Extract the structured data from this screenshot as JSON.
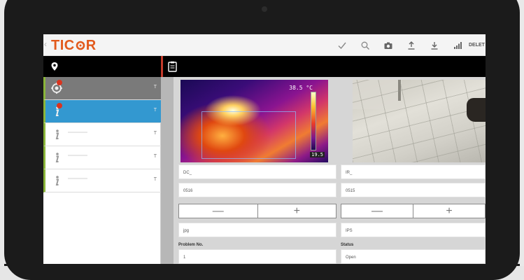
{
  "app": {
    "brand_left": "TIC",
    "brand_right": "R",
    "back_glyph": "‹"
  },
  "appbar_actions": [
    {
      "name": "checkmark-icon",
      "label": ""
    },
    {
      "name": "search-icon",
      "label": ""
    },
    {
      "name": "camera-icon",
      "label": ""
    },
    {
      "name": "upload-icon",
      "label": ""
    },
    {
      "name": "download-icon",
      "label": ""
    },
    {
      "name": "signal-icon",
      "label": ""
    },
    {
      "name": "delete-button",
      "label": "DELET"
    }
  ],
  "toolbar": {
    "left_icon": "location-pin-icon",
    "right_icon": "clipboard-icon"
  },
  "sidebar": {
    "items": [
      {
        "icon": "target-icon",
        "type": "T",
        "state": "gray",
        "badge": true
      },
      {
        "icon": "info-icon",
        "type": "T",
        "state": "selected",
        "badge": true
      },
      {
        "icon": "info-icon",
        "type": "T",
        "state": "normal",
        "badge": false
      },
      {
        "icon": "info-icon",
        "type": "T",
        "state": "normal",
        "badge": false
      },
      {
        "icon": "info-icon",
        "type": "T",
        "state": "normal",
        "badge": false
      }
    ]
  },
  "thermal_image": {
    "max_temp": "38.5 °C",
    "min_temp": "19.5"
  },
  "form": {
    "left": {
      "image_name": "DC_",
      "number": "0516",
      "stepper_minus": "—",
      "stepper_plus": "+",
      "format": "jpg"
    },
    "right": {
      "image_name": "IR_",
      "number": "0515",
      "stepper_minus": "—",
      "stepper_plus": "+",
      "format": "IPS"
    },
    "problem_no_label": "Problem No.",
    "problem_no_value": "1",
    "status_label": "Status",
    "status_value": "Open"
  },
  "colors": {
    "brand_orange": "#e25a1c",
    "selected_blue": "#3398d0",
    "accent_green": "#8ab53a",
    "divider_red": "#c43a2b",
    "badge_red": "#d9341f"
  }
}
